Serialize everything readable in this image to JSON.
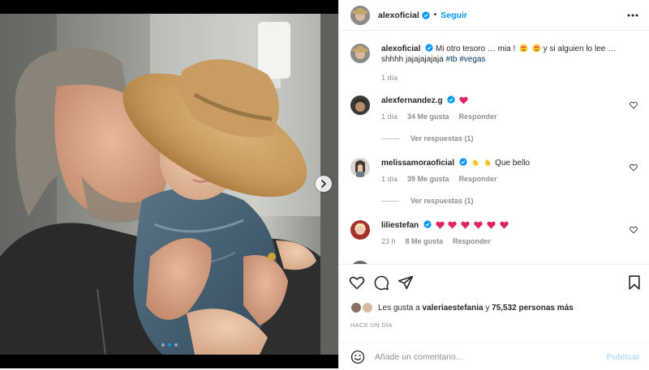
{
  "header": {
    "username": "alexoficial",
    "separator": "•",
    "follow_label": "Seguir"
  },
  "caption": {
    "username": "alexoficial",
    "text_1": "Mi otro tesoro … mia !",
    "text_2": "y si alguien lo lee …",
    "text_3": "shhhh jajajajajaja",
    "hashtags": [
      "#tb",
      "#vegas"
    ],
    "time": "1 día"
  },
  "comments": [
    {
      "username": "alexfernandez.g",
      "emojis": [
        "red-heart"
      ],
      "time": "1 día",
      "likes": "34 Me gusta",
      "reply_label": "Responder",
      "view_replies": "Ver respuestas (1)"
    },
    {
      "username": "melissamoraoficial",
      "emojis": [
        "clapping-hands",
        "clapping-hands"
      ],
      "text": "Que bello",
      "time": "1 día",
      "likes": "39 Me gusta",
      "reply_label": "Responder",
      "view_replies": "Ver respuestas (1)"
    },
    {
      "username": "liliestefan",
      "emojis": [
        "red-heart",
        "red-heart",
        "red-heart",
        "red-heart",
        "red-heart",
        "red-heart"
      ],
      "time": "23 h",
      "likes": "8 Me gusta",
      "reply_label": "Responder"
    }
  ],
  "likes": {
    "prefix": "Les gusta a",
    "user": "valeriaestefania",
    "connector": "y",
    "count": "75,532 personas más"
  },
  "time_ago": "HACE UN DÍA",
  "comment_input": {
    "placeholder": "Añade un comentario..."
  },
  "publish_label": "Publicar",
  "carousel": {
    "current": 2,
    "total": 3
  },
  "colors": {
    "accent": "#0095f6",
    "heart": "#ed4956",
    "text": "#262626",
    "muted": "#8e8e8e",
    "publish_disabled": "#b2dffc"
  }
}
